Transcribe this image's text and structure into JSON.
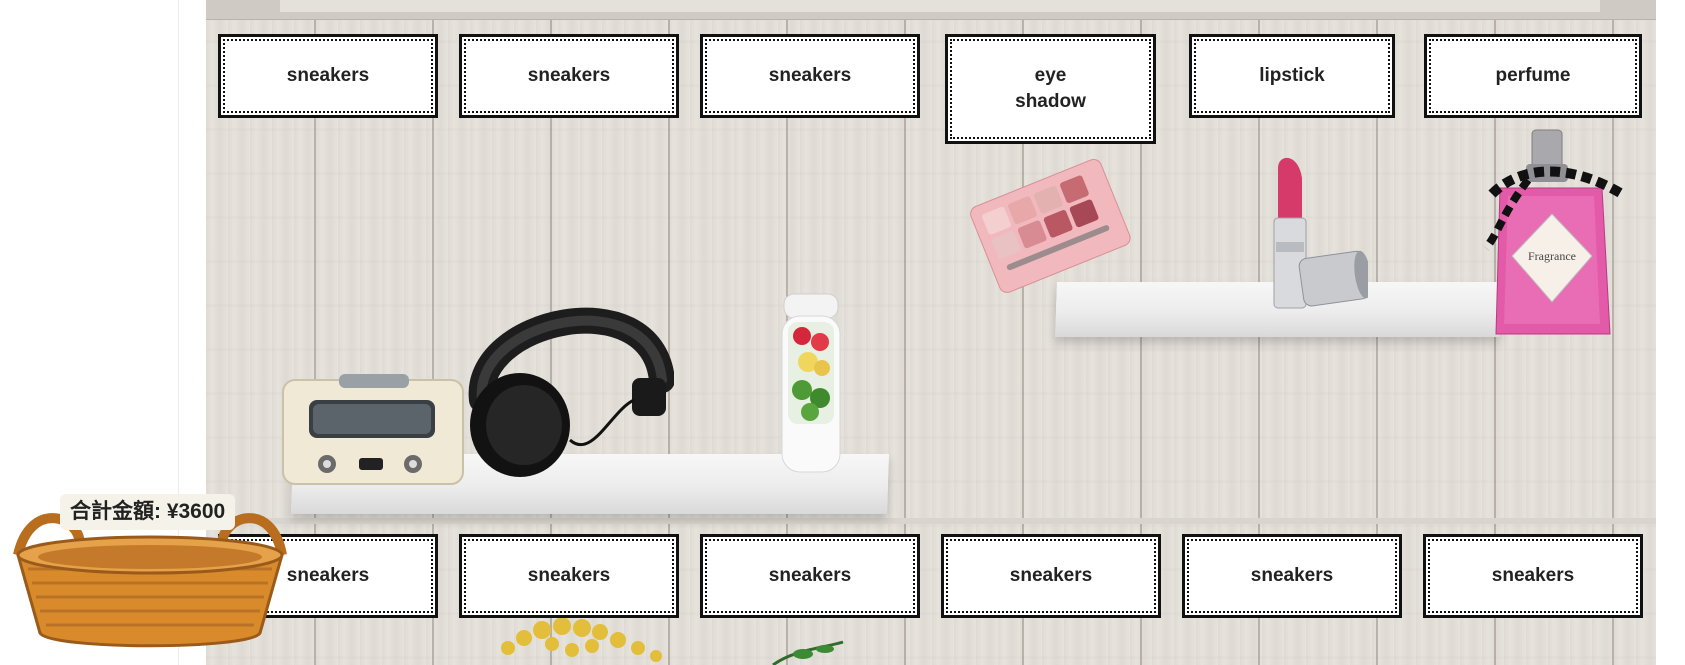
{
  "labels_top": [
    "sneakers",
    "sneakers",
    "sneakers",
    "eye\nshadow",
    "lipstick",
    "perfume"
  ],
  "labels_bottom": [
    "sneakers",
    "sneakers",
    "sneakers",
    "sneakers",
    "sneakers",
    "sneakers"
  ],
  "basket": {
    "total_label": "合計金額: ¥3600"
  },
  "products": {
    "perfume_bottle_text": "Fragrance"
  },
  "colors": {
    "wood": "#e6e2dc",
    "tag_border": "#111111",
    "lipstick": "#d63a6b",
    "perfume": "#e25aa8",
    "eyeshadow": "#e5a2a8",
    "basket": "#d98a2b"
  },
  "icons": [
    "toaster",
    "headphones",
    "smoothie-bottle",
    "eyeshadow-palette",
    "lipstick",
    "perfume-bottle",
    "wicker-basket",
    "flowers",
    "plant"
  ]
}
